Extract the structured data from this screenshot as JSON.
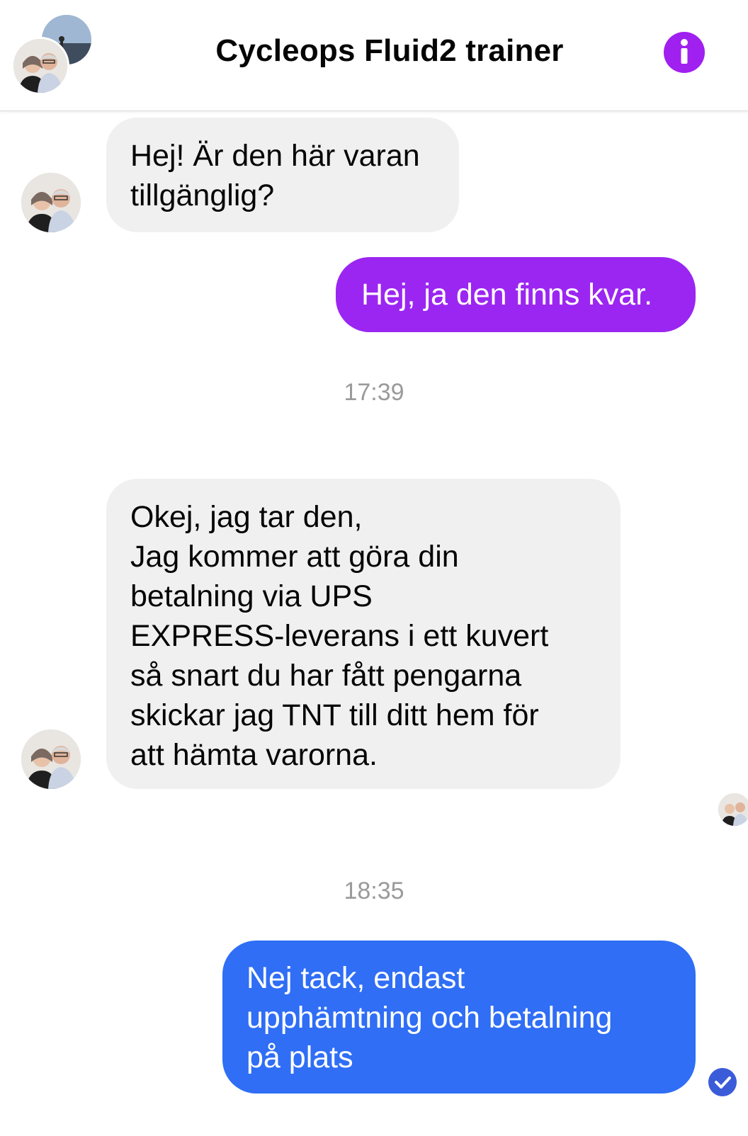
{
  "header": {
    "title": "Cycleops Fluid2 trainer",
    "info_icon": "info-icon",
    "accent_color": "#a020f0"
  },
  "messages": [
    {
      "direction": "incoming",
      "text": "Hej! Är den här varan\ntillgänglig?"
    },
    {
      "direction": "outgoing",
      "text": "Hej, ja den finns kvar.",
      "color": "#9b26f2"
    },
    {
      "timestamp": "17:39"
    },
    {
      "direction": "incoming",
      "text": "Okej, jag tar den,\nJag kommer att göra din\nbetalning via UPS\nEXPRESS-leverans i ett kuvert\nså snart du har fått pengarna\nskickar jag TNT till ditt hem för\natt hämta varorna."
    },
    {
      "timestamp": "18:35"
    },
    {
      "direction": "outgoing",
      "text": "Nej tack,  endast\nupphämtning och betalning\npå plats",
      "color": "#2f6ef5"
    }
  ],
  "status": {
    "seen_icon": "check-circle-icon"
  }
}
